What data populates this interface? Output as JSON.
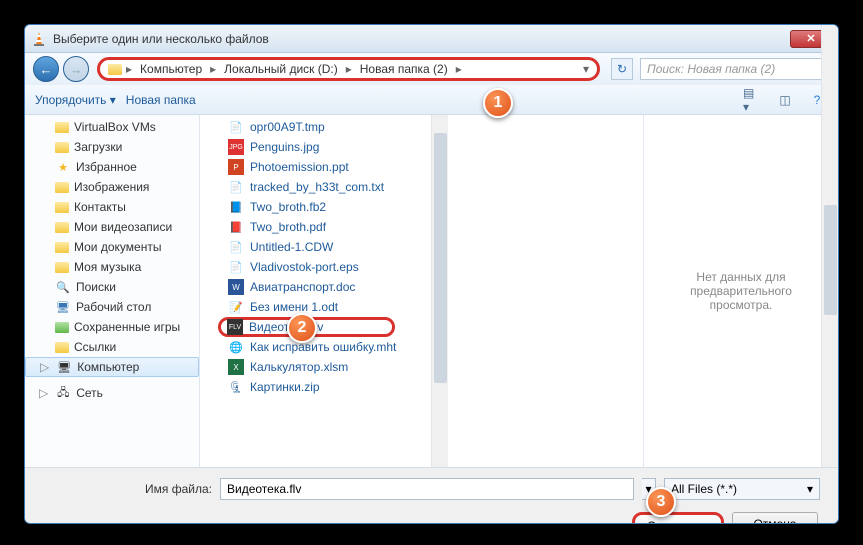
{
  "window": {
    "title": "Выберите один или несколько файлов"
  },
  "breadcrumb": [
    "Компьютер",
    "Локальный диск (D:)",
    "Новая папка (2)"
  ],
  "search": {
    "placeholder": "Поиск: Новая папка (2)"
  },
  "toolbar": {
    "organize": "Упорядочить",
    "newfolder": "Новая папка"
  },
  "tree": [
    {
      "label": "VirtualBox VMs",
      "icon": "folder"
    },
    {
      "label": "Загрузки",
      "icon": "folder"
    },
    {
      "label": "Избранное",
      "icon": "star"
    },
    {
      "label": "Изображения",
      "icon": "pictures"
    },
    {
      "label": "Контакты",
      "icon": "contacts"
    },
    {
      "label": "Мои видеозаписи",
      "icon": "video"
    },
    {
      "label": "Мои документы",
      "icon": "docs"
    },
    {
      "label": "Моя музыка",
      "icon": "music"
    },
    {
      "label": "Поиски",
      "icon": "search"
    },
    {
      "label": "Рабочий стол",
      "icon": "desktop"
    },
    {
      "label": "Сохраненные игры",
      "icon": "games"
    },
    {
      "label": "Ссылки",
      "icon": "links"
    }
  ],
  "tree_computer": "Компьютер",
  "tree_network": "Сеть",
  "files": [
    {
      "name": "opr00A9T.tmp",
      "icon": "tmp"
    },
    {
      "name": "Penguins.jpg",
      "icon": "jpg"
    },
    {
      "name": "Photoemission.ppt",
      "icon": "ppt"
    },
    {
      "name": "tracked_by_h33t_com.txt",
      "icon": "txt"
    },
    {
      "name": "Two_broth.fb2",
      "icon": "fb2"
    },
    {
      "name": "Two_broth.pdf",
      "icon": "pdf"
    },
    {
      "name": "Untitled-1.CDW",
      "icon": "cdw"
    },
    {
      "name": "Vladivostok-port.eps",
      "icon": "eps"
    },
    {
      "name": "Авиатранспорт.doc",
      "icon": "doc"
    },
    {
      "name": "Без имени 1.odt",
      "icon": "odt"
    },
    {
      "name": "Видеотека.flv",
      "icon": "flv",
      "selected": true
    },
    {
      "name": "Как исправить ошибку.mht",
      "icon": "mht"
    },
    {
      "name": "Калькулятор.xlsm",
      "icon": "xls"
    },
    {
      "name": "Картинки.zip",
      "icon": "zip"
    }
  ],
  "preview": {
    "empty": "Нет данных для предварительного просмотра."
  },
  "footer": {
    "filename_label": "Имя файла:",
    "filename_value": "Видеотека.flv",
    "filter": "All Files (*.*)",
    "open": "Открыть",
    "cancel": "Отмена"
  },
  "callouts": {
    "c1": "1",
    "c2": "2",
    "c3": "3"
  }
}
